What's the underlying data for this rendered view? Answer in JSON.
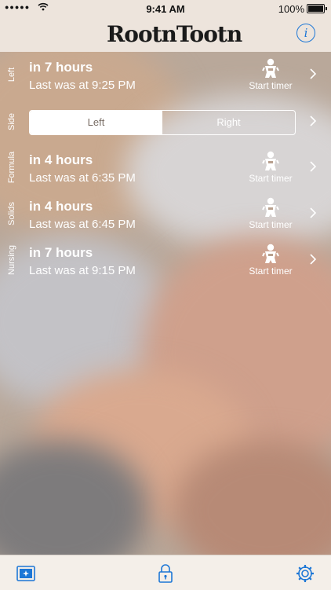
{
  "status_bar": {
    "signal": "●●●●●",
    "time": "9:41 AM",
    "battery_label": "100%"
  },
  "nav": {
    "logo_text": "RootnTootn",
    "info_label": "i"
  },
  "rows": [
    {
      "side": "Left",
      "title": "in 7 hours",
      "subtitle": "Last was at 9:25 PM",
      "action": "Start timer"
    },
    {
      "side": "Side",
      "segments": [
        "Left",
        "Right"
      ],
      "selected": "Left"
    },
    {
      "side": "Formula",
      "title": "in 4 hours",
      "subtitle": "Last was at 6:35 PM",
      "action": "Start timer"
    },
    {
      "side": "Solids",
      "title": "in 4 hours",
      "subtitle": "Last was at 6:45 PM",
      "action": "Start timer"
    },
    {
      "side": "Nursing",
      "title": "in 7 hours",
      "subtitle": "Last was at 9:15 PM",
      "action": "Start timer"
    }
  ],
  "tab_bar": {
    "icons": [
      "photo-icon",
      "lock-icon",
      "gear-icon"
    ],
    "accent": "#1d77d6"
  }
}
